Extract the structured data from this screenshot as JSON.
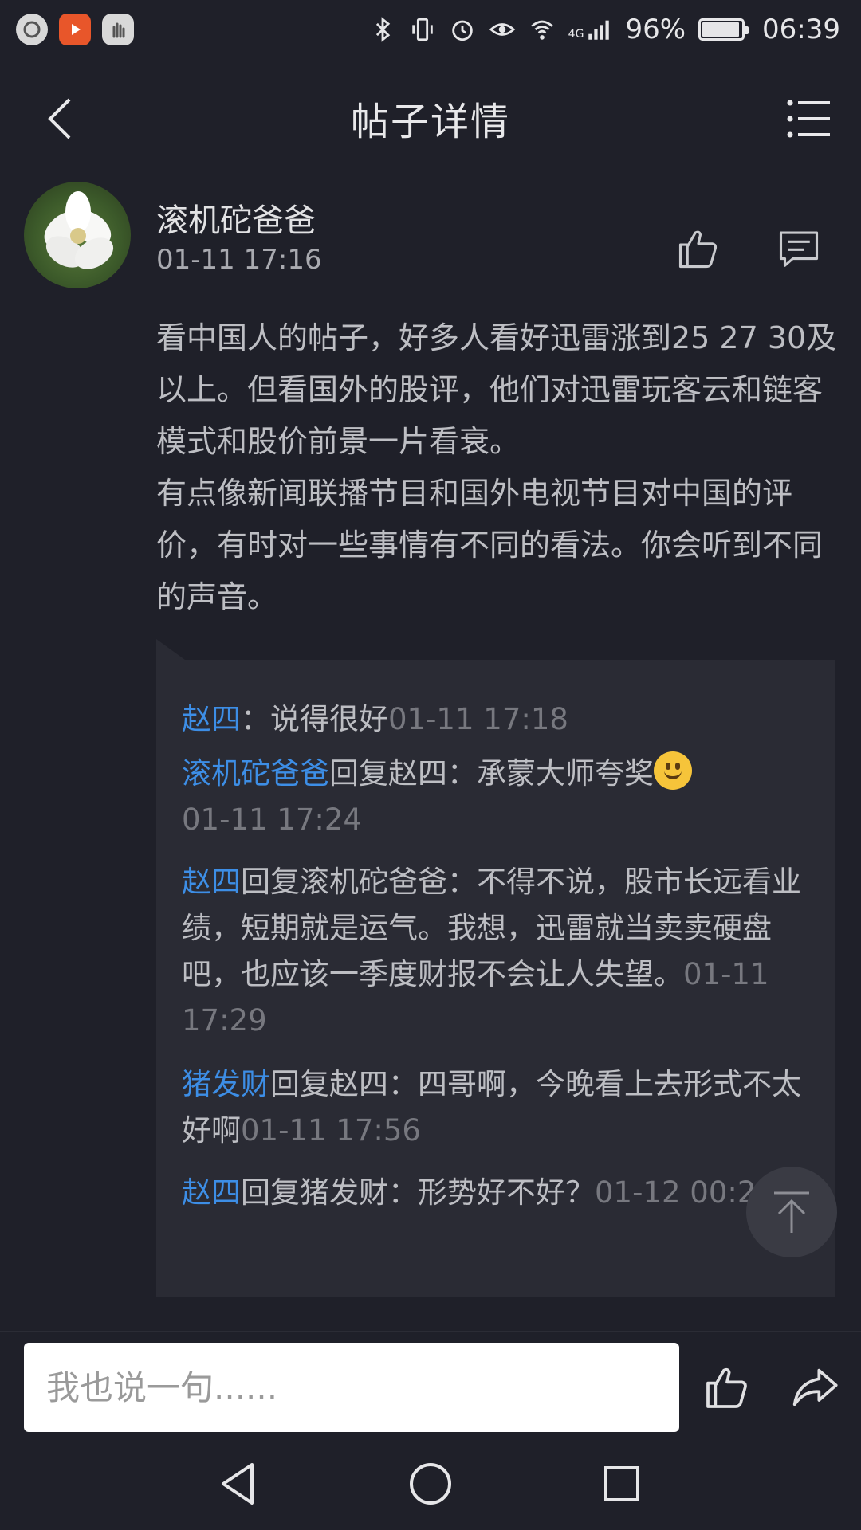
{
  "status_bar": {
    "battery": "96%",
    "time": "06:39",
    "network": "4G"
  },
  "header": {
    "title": "帖子详情"
  },
  "post": {
    "author": "滚机砣爸爸",
    "time": "01-11 17:16",
    "body": "看中国人的帖子，好多人看好迅雷涨到25 27 30及以上。但看国外的股评，他们对迅雷玩客云和链客模式和股价前景一片看衰。\n有点像新闻联播节目和国外电视节目对中国的评价，有时对一些事情有不同的看法。你会听到不同的声音。"
  },
  "replies": [
    {
      "user": "赵四",
      "reply_to_label": "",
      "reply_to": "",
      "sep": "：",
      "text": "说得很好",
      "time": "01-11 17:18",
      "emoji": false
    },
    {
      "user": "滚机砣爸爸",
      "reply_to_label": "回复",
      "reply_to": "赵四",
      "sep": "：",
      "text": "承蒙大师夸奖",
      "time": "01-11 17:24",
      "emoji": true
    },
    {
      "user": "赵四",
      "reply_to_label": "回复",
      "reply_to": "滚机砣爸爸",
      "sep": "：",
      "text": "不得不说，股市长远看业绩，短期就是运气。我想，迅雷就当卖卖硬盘吧，也应该一季度财报不会让人失望。",
      "time": "01-11 17:29",
      "emoji": false
    },
    {
      "user": "猪发财",
      "reply_to_label": "回复",
      "reply_to": "赵四",
      "sep": "：",
      "text": "四哥啊，今晚看上去形式不太好啊",
      "time": "01-11 17:56",
      "emoji": false
    },
    {
      "user": "赵四",
      "reply_to_label": "回复",
      "reply_to": "猪发财",
      "sep": "：",
      "text": "形势好不好？",
      "time": "01-12 00:25",
      "emoji": false
    }
  ],
  "input": {
    "placeholder": "我也说一句......"
  },
  "colors": {
    "background": "#1f2029",
    "reply_background": "#2a2b34",
    "username_blue": "#3d8ee6"
  }
}
